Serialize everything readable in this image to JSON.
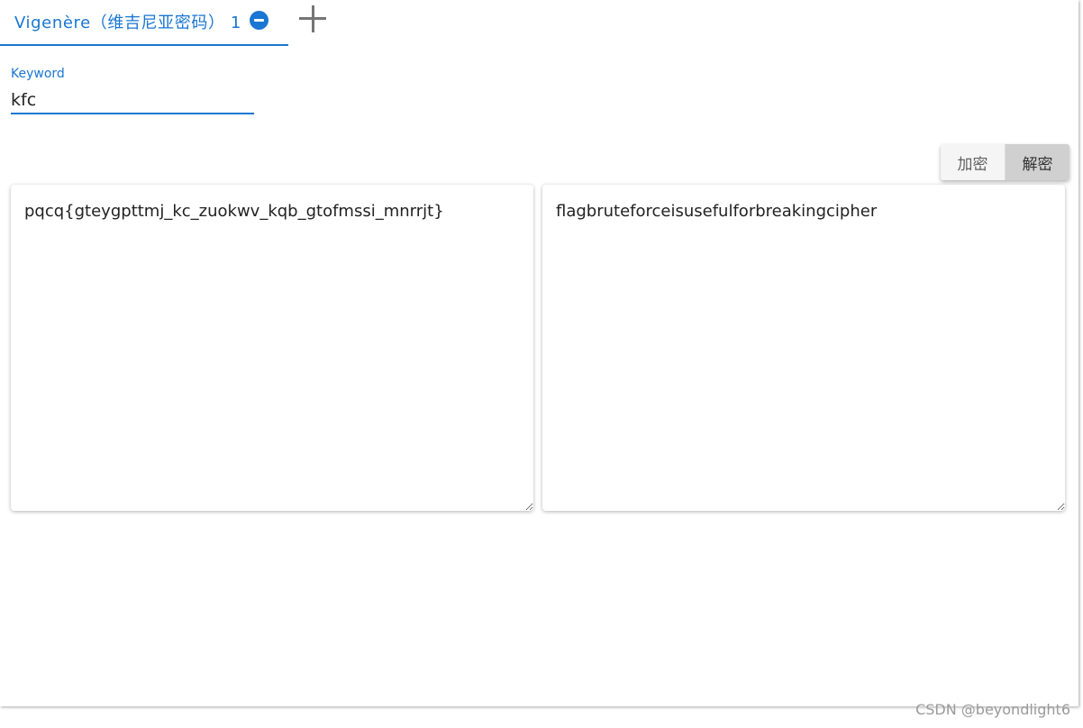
{
  "tabs": [
    {
      "label": "Vigenère（维吉尼亚密码） 1",
      "active": true,
      "close_icon": "minus-circle-icon"
    }
  ],
  "add_tab_icon": "plus-icon",
  "keyword": {
    "label": "Keyword",
    "value": "kfc"
  },
  "mode_toggle": {
    "encrypt_label": "加密",
    "decrypt_label": "解密",
    "selected": "解密"
  },
  "input_text": "pqcq{gteygpttmj_kc_zuokwv_kqb_gtofmssi_mnrrjt}",
  "output_text": "flagbruteforceisusefulforbreakingcipher",
  "watermark": "CSDN @beyondlight6",
  "colors": {
    "accent": "#1976d2",
    "toggle_active": "#d0d0d0"
  }
}
